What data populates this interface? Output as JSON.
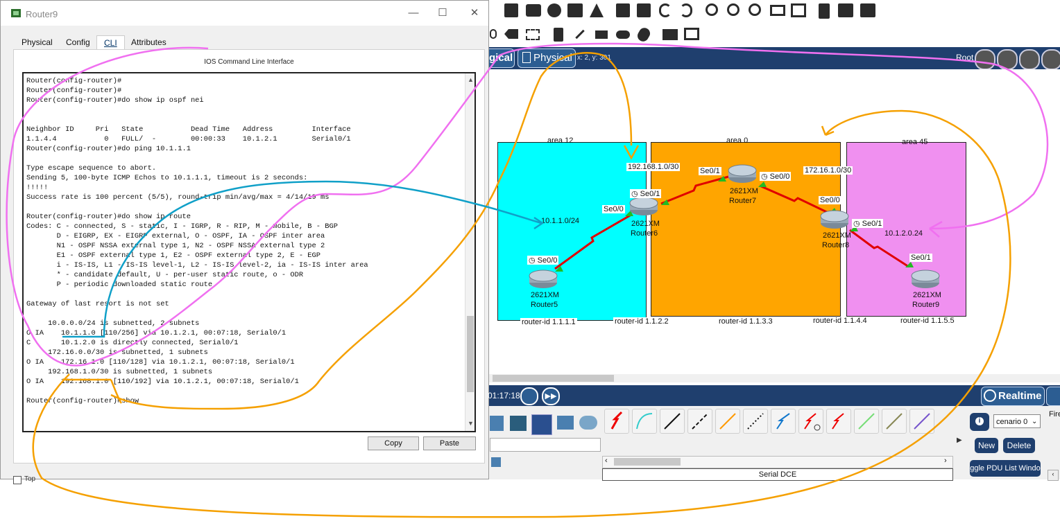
{
  "window": {
    "title": "Router9",
    "minimize": "—",
    "maximize": "☐",
    "close": "✕"
  },
  "tabs": [
    {
      "label": "Physical"
    },
    {
      "label": "Config"
    },
    {
      "label": "CLI"
    },
    {
      "label": "Attributes"
    }
  ],
  "cli": {
    "header": "IOS Command Line Interface",
    "terminal": "Router(config-router)#\nRouter(config-router)#\nRouter(config-router)#do show ip ospf nei\n\n\nNeighbor ID     Pri   State           Dead Time   Address         Interface\n1.1.4.4           0   FULL/  -        00:00:33    10.1.2.1        Serial0/1\nRouter(config-router)#do ping 10.1.1.1\n\nType escape sequence to abort.\nSending 5, 100-byte ICMP Echos to 10.1.1.1, timeout is 2 seconds:\n!!!!!\nSuccess rate is 100 percent (5/5), round-trip min/avg/max = 4/14/19 ms\n\nRouter(config-router)#do show ip route\nCodes: C - connected, S - static, I - IGRP, R - RIP, M - mobile, B - BGP\n       D - EIGRP, EX - EIGRP external, O - OSPF, IA - OSPF inter area\n       N1 - OSPF NSSA external type 1, N2 - OSPF NSSA external type 2\n       E1 - OSPF external type 1, E2 - OSPF external type 2, E - EGP\n       i - IS-IS, L1 - IS-IS level-1, L2 - IS-IS level-2, ia - IS-IS inter area\n       * - candidate default, U - per-user static route, o - ODR\n       P - periodic downloaded static route\n\nGateway of last resort is not set\n\n     10.0.0.0/24 is subnetted, 2 subnets\nO IA    10.1.1.0 [110/256] via 10.1.2.1, 00:07:18, Serial0/1\nC       10.1.2.0 is directly connected, Serial0/1\n     172.16.0.0/30 is subnetted, 1 subnets\nO IA    172.16.1.0 [110/128] via 10.1.2.1, 00:07:18, Serial0/1\n     192.168.1.0/30 is subnetted, 1 subnets\nO IA    192.168.1.0 [110/192] via 10.1.2.1, 00:07:18, Serial0/1\n\nRouter(config-router)#show",
    "copy_label": "Copy",
    "paste_label": "Paste",
    "top_checkbox_label": "Top"
  },
  "workspace": {
    "logical_label": "gical",
    "physical_label": "Physical",
    "coords": "x: 2, y: 301",
    "root_label": "Root"
  },
  "topology": {
    "areas": [
      {
        "name": "area 12",
        "color": "#00ffff"
      },
      {
        "name": "area 0",
        "color": "#ffa500"
      },
      {
        "name": "area 45",
        "color": "#f090f0"
      }
    ],
    "routers": [
      {
        "model": "2621XM",
        "name": "Router5",
        "router_id": "router-id 1.1.1.1"
      },
      {
        "model": "2621XM",
        "name": "Router6",
        "router_id": "router-id 1.1.2.2"
      },
      {
        "model": "2621XM",
        "name": "Router7",
        "router_id": "router-id 1.1.3.3"
      },
      {
        "model": "2621XM",
        "name": "Router8",
        "router_id": "router-id 1.1.4.4"
      },
      {
        "model": "2621XM",
        "name": "Router9",
        "router_id": "router-id 1.1.5.5"
      }
    ],
    "networks": [
      "10.1.1.0/24",
      "192.168.1.0/30",
      "172.16.1.0/30",
      "10.1.2.0.24"
    ],
    "interfaces": {
      "r5_se00": "Se0/0",
      "r6_se00": "Se0/0",
      "r6_se01": "Se0/1",
      "r7_se01": "Se0/1",
      "r7_se00": "Se0/0",
      "r8_se00": "Se0/0",
      "r8_se01": "Se0/1",
      "r9_se01": "Se0/1"
    },
    "link_color": "#e00000",
    "port_color": "#22bb22"
  },
  "simulation": {
    "time": "01:17:18",
    "realtime_label": "Realtime",
    "connection_type": "Serial DCE",
    "scenario": "cenario 0",
    "new_label": "New",
    "delete_label": "Delete",
    "toggle_pdu_label": "ggle PDU List Windo",
    "fire_label": "Fire",
    "info_label": "i"
  },
  "annotations": {
    "pink": "#f070f0",
    "orange": "#f5a000",
    "blue": "#10a0c8"
  }
}
